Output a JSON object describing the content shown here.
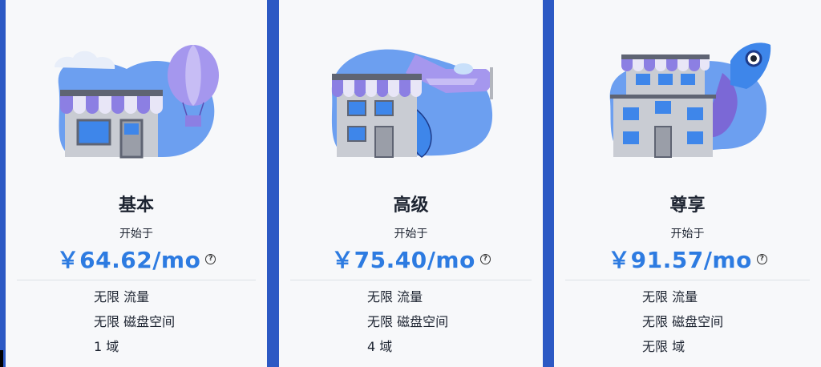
{
  "plans": [
    {
      "title": "基本",
      "starting_label": "开始于",
      "price": "￥64.62/mo",
      "features": [
        "无限 流量",
        "无限 磁盘空间",
        "1 域"
      ]
    },
    {
      "title": "高级",
      "starting_label": "开始于",
      "price": "￥75.40/mo",
      "features": [
        "无限 流量",
        "无限 磁盘空间",
        "4 域"
      ]
    },
    {
      "title": "尊享",
      "starting_label": "开始于",
      "price": "￥91.57/mo",
      "features": [
        "无限 流量",
        "无限 磁盘空间",
        "无限 域"
      ]
    }
  ],
  "help_icon_glyph": "?",
  "colors": {
    "background": "#2c59c4",
    "card": "#f7f8fa",
    "price": "#2d7be1",
    "blob": "#6c9ff0",
    "awning_purple": "#8c7fe3",
    "awning_white": "#e8e6f7",
    "building": "#c9ccd3",
    "window": "#3e86ea"
  }
}
